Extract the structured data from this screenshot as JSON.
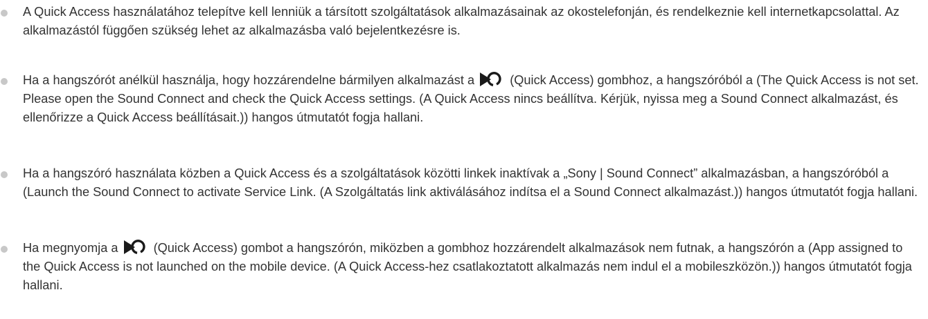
{
  "items": [
    {
      "text": "A Quick Access használatához telepítve kell lenniük a társított szolgáltatások alkalmazásainak az okostelefonján, és rendelkeznie kell internetkapcsolattal. Az alkalmazástól függően szükség lehet az alkalmazásba való bejelentkezésre is."
    },
    {
      "before_icon": "Ha a hangszórót anélkül használja, hogy hozzárendelne bármilyen alkalmazást a",
      "icon": "quick-access-icon",
      "after_icon": " (Quick Access) gombhoz, a hangszóróból a (The Quick Access is not set. Please open the Sound Connect and check the Quick Access settings. (A Quick Access nincs beállítva. Kérjük, nyissa meg a Sound Connect alkalmazást, és ellenőrizze a Quick Access beállításait.)) hangos útmutatót fogja hallani."
    },
    {
      "text": "Ha a hangszóró használata közben a Quick Access és a szolgáltatások közötti linkek inaktívak a „Sony | Sound Connect” alkalmazásban, a hangszóróból a (Launch the Sound Connect to activate Service Link. (A Szolgáltatás link aktiválásához indítsa el a Sound Connect alkalmazást.)) hangos útmutatót fogja hallani."
    },
    {
      "before_icon": "Ha megnyomja a",
      "icon": "quick-access-icon",
      "after_icon": " (Quick Access) gombot a hangszórón, miközben a gombhoz hozzárendelt alkalmazások nem futnak, a hangszórón a (App assigned to the Quick Access is not launched on the mobile device. (A Quick Access-hez csatlakoztatott alkalmazás nem indul el a mobileszközön.)) hangos útmutatót fogja hallani."
    }
  ],
  "colors": {
    "text": "#333333",
    "bullet": "#c8c8c8",
    "icon": "#1a1a1a"
  }
}
